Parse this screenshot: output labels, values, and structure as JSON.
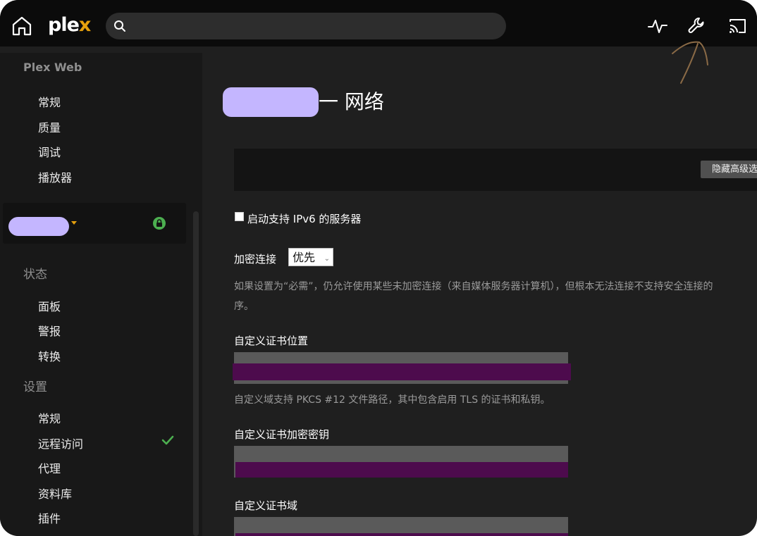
{
  "topbar": {
    "logo_main": "ple",
    "logo_accent": "x",
    "search_placeholder": "",
    "icons": [
      "home-icon",
      "search-icon",
      "activity-icon",
      "wrench-icon",
      "cast-icon"
    ]
  },
  "sidebar": {
    "app_title": "Plex Web",
    "web_items": [
      "常规",
      "质量",
      "调试",
      "播放器"
    ],
    "status_section": "状态",
    "status_items": [
      "面板",
      "警报",
      "转换"
    ],
    "settings_section": "设置",
    "settings_items": [
      "常规",
      "远程访问",
      "代理",
      "资料库",
      "插件"
    ]
  },
  "main": {
    "title": "一 网络",
    "advanced_button": "隐藏高级选项",
    "ipv6_label": "启动支持 IPv6 的服务器",
    "ipv6_checked": false,
    "encryption_label": "加密连接",
    "encryption_value": "优先",
    "encryption_help_line1": "如果设置为“必需”，仍允许使用某些未加密连接（来自媒体服务器计算机），但根本无法连接不支持安全连接的",
    "encryption_help_line2": "序。",
    "cert_location_label": "自定义证书位置",
    "cert_location_help": "自定义域支持 PKCS #12 文件路径，其中包含启用 TLS 的证书和私钥。",
    "cert_key_label": "自定义证书加密密钥",
    "cert_domain_label": "自定义证书域"
  },
  "colors": {
    "accent": "#e5a00d",
    "redaction_pill": "#c4b6ff",
    "redaction_bar": "#4d0b4d",
    "check_green": "#4caf50"
  }
}
